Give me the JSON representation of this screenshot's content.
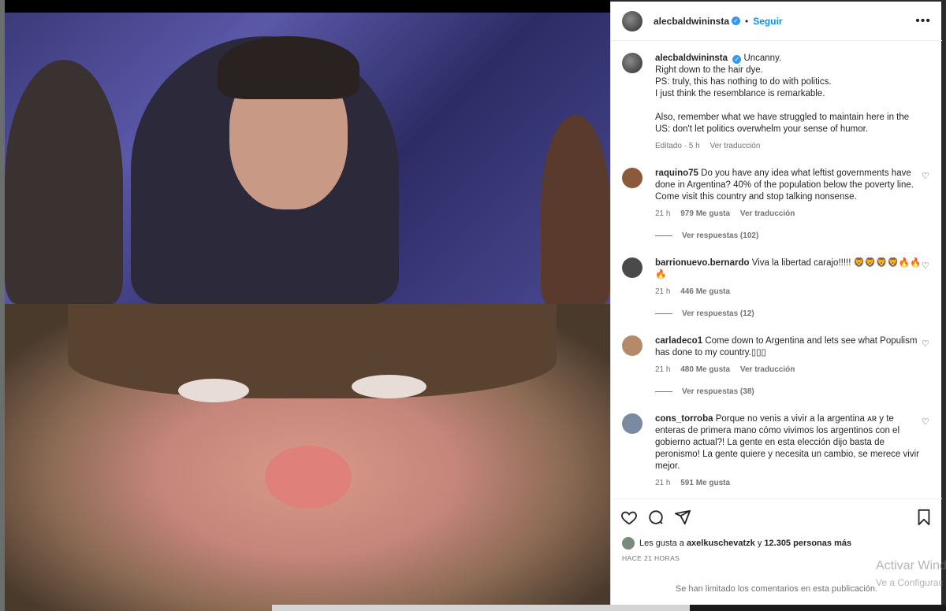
{
  "post": {
    "username": "alecbaldwininsta",
    "follow_label": "Seguir",
    "separator": "•",
    "more_label": "•••",
    "caption_lines": [
      "Uncanny.",
      "Right down to the hair dye.",
      "PS: truly, this has nothing to do with politics.",
      "I just think the resemblance is remarkable.",
      "",
      "Also, remember what we have struggled to maintain here in the US: don't let politics overwhelm your sense of humor."
    ],
    "caption_meta_time": "Editado · 5 h",
    "caption_meta_translate": "Ver traducción"
  },
  "comments": [
    {
      "user": "raquino75",
      "text": "Do you have any idea what leftist governments have done in Argentina? 40% of the population below the poverty line. Come visit this country and stop talking nonsense.",
      "time": "21 h",
      "likes": "979 Me gusta",
      "translate": "Ver traducción",
      "replies": "Ver respuestas (102)"
    },
    {
      "user": "barrionuevo.bernardo",
      "text": "Viva la libertad carajo!!!!! 🦁🦁🦁🦁🔥🔥🔥",
      "time": "21 h",
      "likes": "446 Me gusta",
      "translate": "",
      "replies": "Ver respuestas (12)"
    },
    {
      "user": "carladeco1",
      "text": "Come down to Argentina and lets see what Populism has done to my country.▯▯▯",
      "time": "21 h",
      "likes": "480 Me gusta",
      "translate": "Ver traducción",
      "replies": "Ver respuestas (38)"
    },
    {
      "user": "cons_torroba",
      "text": "Porque no venis a vivir a la argentina ᴀʀ y te enteras de primera mano cómo vivimos los argentinos con el gobierno actual?! La gente en esta elección dijo basta de peronismo! La gente quiere y necesita un cambio, se merece vivir mejor.",
      "time": "21 h",
      "likes": "591 Me gusta",
      "translate": "",
      "replies": ""
    }
  ],
  "actions": {
    "likes_prefix": "Les gusta a",
    "likes_user": "axelkuschevatzk",
    "likes_mid": "y",
    "likes_count": "12.305 personas más",
    "time_ago": "HACE 21 HORAS",
    "limited_comments": "Se han limitado los comentarios en esta publicación."
  },
  "icons": {
    "like": "heart-outline-icon",
    "comment": "comment-bubble-icon",
    "share": "paper-plane-icon",
    "save": "bookmark-icon",
    "verified": "verified-badge-icon",
    "more": "more-options-icon"
  },
  "system": {
    "watermark_line1": "Activar Wind",
    "watermark_line2": "Ve a Configurac"
  },
  "colors": {
    "link": "#0095f6",
    "verified": "#3797f0",
    "text": "#262626",
    "meta": "#737373"
  }
}
